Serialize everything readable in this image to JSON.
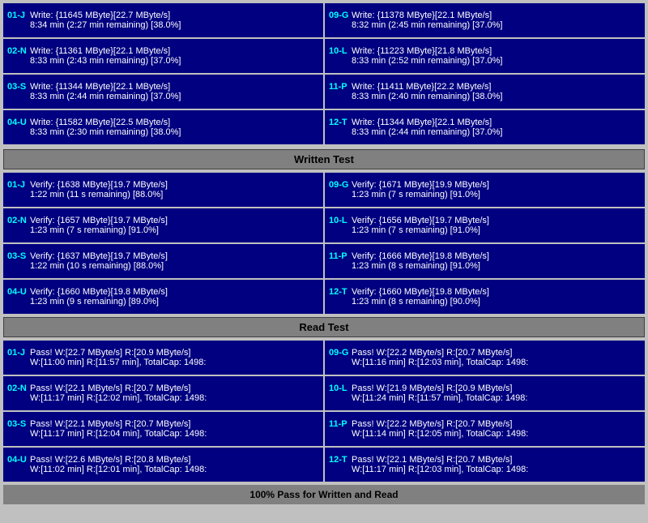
{
  "sections": {
    "write_test": {
      "header": "Written Test",
      "rows_left": [
        {
          "id": "01-J",
          "line1": "Write: {11645 MByte}[22.7 MByte/s]",
          "line2": "8:34 min (2:27 min remaining)  [38.0%]"
        },
        {
          "id": "02-N",
          "line1": "Write: {11361 MByte}[22.1 MByte/s]",
          "line2": "8:33 min (2:43 min remaining)  [37.0%]"
        },
        {
          "id": "03-S",
          "line1": "Write: {11344 MByte}[22.1 MByte/s]",
          "line2": "8:33 min (2:44 min remaining)  [37.0%]"
        },
        {
          "id": "04-U",
          "line1": "Write: {11582 MByte}[22.5 MByte/s]",
          "line2": "8:33 min (2:30 min remaining)  [38.0%]"
        }
      ],
      "rows_right": [
        {
          "id": "09-G",
          "line1": "Write: {11378 MByte}[22.1 MByte/s]",
          "line2": "8:32 min (2:45 min remaining)  [37.0%]"
        },
        {
          "id": "10-L",
          "line1": "Write: {11223 MByte}[21.8 MByte/s]",
          "line2": "8:33 min (2:52 min remaining)  [37.0%]"
        },
        {
          "id": "11-P",
          "line1": "Write: {11411 MByte}[22.2 MByte/s]",
          "line2": "8:33 min (2:40 min remaining)  [38.0%]"
        },
        {
          "id": "12-T",
          "line1": "Write: {11344 MByte}[22.1 MByte/s]",
          "line2": "8:33 min (2:44 min remaining)  [37.0%]"
        }
      ]
    },
    "verify_test": {
      "header": "Written Test",
      "rows_left": [
        {
          "id": "01-J",
          "line1": "Verify: {1638 MByte}[19.7 MByte/s]",
          "line2": "1:22 min (11 s remaining)   [88.0%]"
        },
        {
          "id": "02-N",
          "line1": "Verify: {1657 MByte}[19.7 MByte/s]",
          "line2": "1:23 min (7 s remaining)   [91.0%]"
        },
        {
          "id": "03-S",
          "line1": "Verify: {1637 MByte}[19.7 MByte/s]",
          "line2": "1:22 min (10 s remaining)   [88.0%]"
        },
        {
          "id": "04-U",
          "line1": "Verify: {1660 MByte}[19.8 MByte/s]",
          "line2": "1:23 min (9 s remaining)   [89.0%]"
        }
      ],
      "rows_right": [
        {
          "id": "09-G",
          "line1": "Verify: {1671 MByte}[19.9 MByte/s]",
          "line2": "1:23 min (7 s remaining)   [91.0%]"
        },
        {
          "id": "10-L",
          "line1": "Verify: {1656 MByte}[19.7 MByte/s]",
          "line2": "1:23 min (7 s remaining)   [91.0%]"
        },
        {
          "id": "11-P",
          "line1": "Verify: {1666 MByte}[19.8 MByte/s]",
          "line2": "1:23 min (8 s remaining)   [91.0%]"
        },
        {
          "id": "12-T",
          "line1": "Verify: {1660 MByte}[19.8 MByte/s]",
          "line2": "1:23 min (8 s remaining)   [90.0%]"
        }
      ]
    },
    "read_test": {
      "header": "Read Test",
      "rows_left": [
        {
          "id": "01-J",
          "line1": "Pass! W:[22.7 MByte/s] R:[20.9 MByte/s]",
          "line2": "W:[11:00 min] R:[11:57 min], TotalCap: 1498:"
        },
        {
          "id": "02-N",
          "line1": "Pass! W:[22.1 MByte/s] R:[20.7 MByte/s]",
          "line2": "W:[11:17 min] R:[12:02 min], TotalCap: 1498:"
        },
        {
          "id": "03-S",
          "line1": "Pass! W:[22.1 MByte/s] R:[20.7 MByte/s]",
          "line2": "W:[11:17 min] R:[12:04 min], TotalCap: 1498:"
        },
        {
          "id": "04-U",
          "line1": "Pass! W:[22.6 MByte/s] R:[20.8 MByte/s]",
          "line2": "W:[11:02 min] R:[12:01 min], TotalCap: 1498:"
        }
      ],
      "rows_right": [
        {
          "id": "09-G",
          "line1": "Pass! W:[22.2 MByte/s] R:[20.7 MByte/s]",
          "line2": "W:[11:16 min] R:[12:03 min], TotalCap: 1498:"
        },
        {
          "id": "10-L",
          "line1": "Pass! W:[21.9 MByte/s] R:[20.9 MByte/s]",
          "line2": "W:[11:24 min] R:[11:57 min], TotalCap: 1498:"
        },
        {
          "id": "11-P",
          "line1": "Pass! W:[22.2 MByte/s] R:[20.7 MByte/s]",
          "line2": "W:[11:14 min] R:[12:05 min], TotalCap: 1498:"
        },
        {
          "id": "12-T",
          "line1": "Pass! W:[22.1 MByte/s] R:[20.7 MByte/s]",
          "line2": "W:[11:17 min] R:[12:03 min], TotalCap: 1498:"
        }
      ]
    }
  },
  "bottom_status": "100% Pass for Written and Read",
  "header_written_test": "Written Test",
  "header_read_test": "Read Test"
}
